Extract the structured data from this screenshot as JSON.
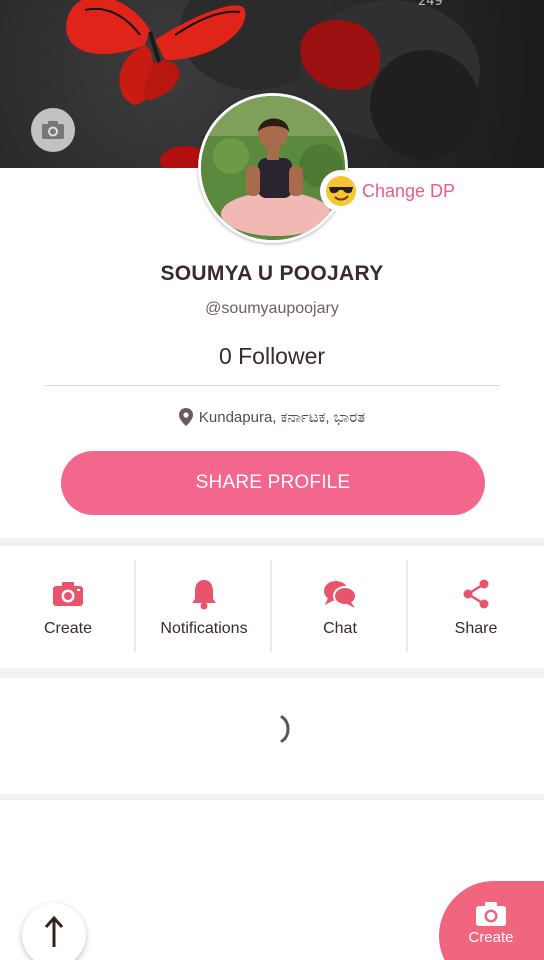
{
  "cover": {
    "status_number": "249",
    "camera_icon": "camera-icon"
  },
  "profile": {
    "change_dp_label": "Change DP",
    "name": "SOUMYA U POOJARY",
    "handle": "@soumyaupoojary",
    "followers": "0 Follower",
    "location": "Kundapura, ಕರ್ನಾಟಕ, ಭಾರತ",
    "share_button": "SHARE PROFILE"
  },
  "actions": [
    {
      "label": "Create",
      "icon": "camera-icon"
    },
    {
      "label": "Notifications",
      "icon": "bell-icon"
    },
    {
      "label": "Chat",
      "icon": "chat-icon"
    },
    {
      "label": "Share",
      "icon": "share-icon"
    }
  ],
  "fab": {
    "create_label": "Create",
    "icon": "camera-icon"
  },
  "colors": {
    "accent": "#f4678c",
    "text": "#3a2a2a"
  }
}
